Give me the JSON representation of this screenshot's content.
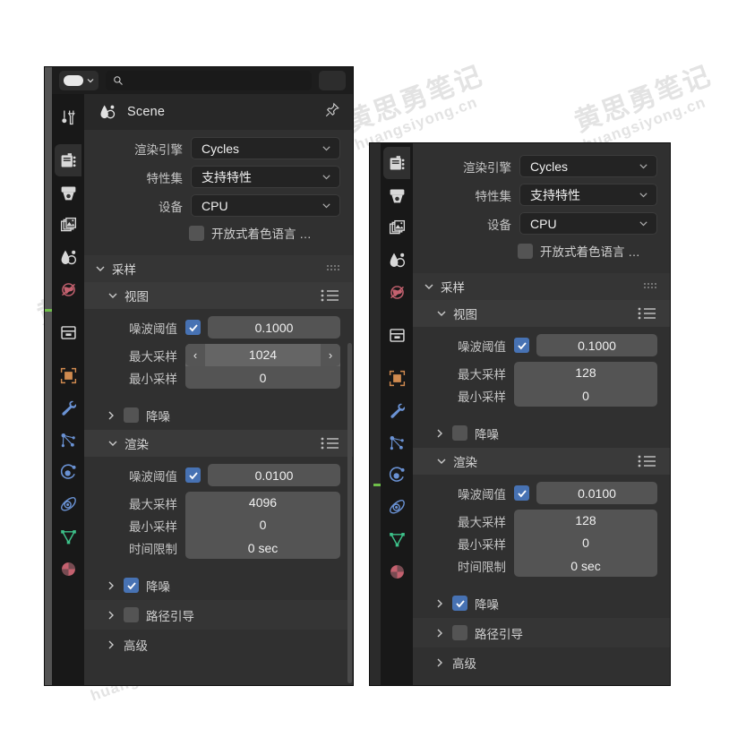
{
  "watermark": {
    "cn": "黄思勇笔记",
    "en": "huangsiyong.cn"
  },
  "panels": {
    "back": {
      "header": {
        "title": "Scene",
        "icon": "scene-icon",
        "pin_icon": "pin-icon"
      },
      "toolbar": {
        "search_icon": "search-icon"
      },
      "properties": [
        {
          "label": "渲染引擎",
          "value": "Cycles",
          "type": "dropdown"
        },
        {
          "label": "特性集",
          "value": "支持特性",
          "type": "dropdown"
        },
        {
          "label": "设备",
          "value": "CPU",
          "type": "dropdown"
        }
      ],
      "osl": {
        "label": "开放式着色语言 …",
        "checked": false
      },
      "sampling": {
        "title": "采样",
        "viewport": {
          "title": "视图",
          "noise_threshold": {
            "label": "噪波阈值",
            "checked": true,
            "value": "0.1000"
          },
          "max_samples": {
            "label": "最大采样",
            "value": "1024",
            "hovered": true
          },
          "min_samples": {
            "label": "最小采样",
            "value": "0"
          },
          "denoise": {
            "label": "降噪",
            "checked": false
          }
        },
        "render": {
          "title": "渲染",
          "noise_threshold": {
            "label": "噪波阈值",
            "checked": true,
            "value": "0.0100"
          },
          "max_samples": {
            "label": "最大采样",
            "value": "4096"
          },
          "min_samples": {
            "label": "最小采样",
            "value": "0"
          },
          "time_limit": {
            "label": "时间限制",
            "value": "0 sec"
          },
          "denoise": {
            "label": "降噪",
            "checked": true
          }
        },
        "path_guiding": {
          "label": "路径引导",
          "checked": false
        },
        "advanced": {
          "label": "高级"
        }
      }
    },
    "front": {
      "properties": [
        {
          "label": "渲染引擎",
          "value": "Cycles",
          "type": "dropdown"
        },
        {
          "label": "特性集",
          "value": "支持特性",
          "type": "dropdown"
        },
        {
          "label": "设备",
          "value": "CPU",
          "type": "dropdown"
        }
      ],
      "osl": {
        "label": "开放式着色语言 …",
        "checked": false
      },
      "sampling": {
        "title": "采样",
        "viewport": {
          "title": "视图",
          "noise_threshold": {
            "label": "噪波阈值",
            "checked": true,
            "value": "0.1000"
          },
          "max_samples": {
            "label": "最大采样",
            "value": "128"
          },
          "min_samples": {
            "label": "最小采样",
            "value": "0"
          },
          "denoise": {
            "label": "降噪",
            "checked": false
          }
        },
        "render": {
          "title": "渲染",
          "noise_threshold": {
            "label": "噪波阈值",
            "checked": true,
            "value": "0.0100"
          },
          "max_samples": {
            "label": "最大采样",
            "value": "128"
          },
          "min_samples": {
            "label": "最小采样",
            "value": "0"
          },
          "time_limit": {
            "label": "时间限制",
            "value": "0 sec"
          },
          "denoise": {
            "label": "降噪",
            "checked": true
          }
        },
        "path_guiding": {
          "label": "路径引导",
          "checked": false
        },
        "advanced": {
          "label": "高级"
        }
      }
    }
  },
  "tabs": [
    {
      "name": "tool",
      "icon": "tool-icon",
      "color": "#d8d8d8"
    },
    {
      "name": "render",
      "icon": "render-icon",
      "color": "#d8d8d8"
    },
    {
      "name": "output",
      "icon": "output-icon",
      "color": "#d8d8d8"
    },
    {
      "name": "viewlayer",
      "icon": "viewlayer-icon",
      "color": "#d8d8d8"
    },
    {
      "name": "scene",
      "icon": "scene-icon",
      "color": "#d8d8d8"
    },
    {
      "name": "world",
      "icon": "world-icon",
      "color": "#c4616f"
    },
    {
      "name": "collection",
      "icon": "collection-icon",
      "color": "#d8d8d8"
    },
    {
      "name": "object",
      "icon": "object-icon",
      "color": "#d08a4f"
    },
    {
      "name": "modifier",
      "icon": "wrench-icon",
      "color": "#6a92d4"
    },
    {
      "name": "particles",
      "icon": "particles-icon",
      "color": "#6a92d4"
    },
    {
      "name": "physics",
      "icon": "physics-icon",
      "color": "#6a92d4"
    },
    {
      "name": "constraint",
      "icon": "constraint-icon",
      "color": "#6a92d4"
    },
    {
      "name": "data",
      "icon": "mesh-data-icon",
      "color": "#3dc28a"
    },
    {
      "name": "material",
      "icon": "material-icon",
      "color": "#c4616f"
    }
  ],
  "colors": {
    "panel_bg": "#303030",
    "tabstrip_bg": "#181818",
    "header_bg": "#282828",
    "field_bg": "#545454",
    "dropdown_bg": "#232323",
    "checkbox_on": "#4772b3",
    "section_bg": "#353535",
    "text": "#d6d6d6"
  }
}
